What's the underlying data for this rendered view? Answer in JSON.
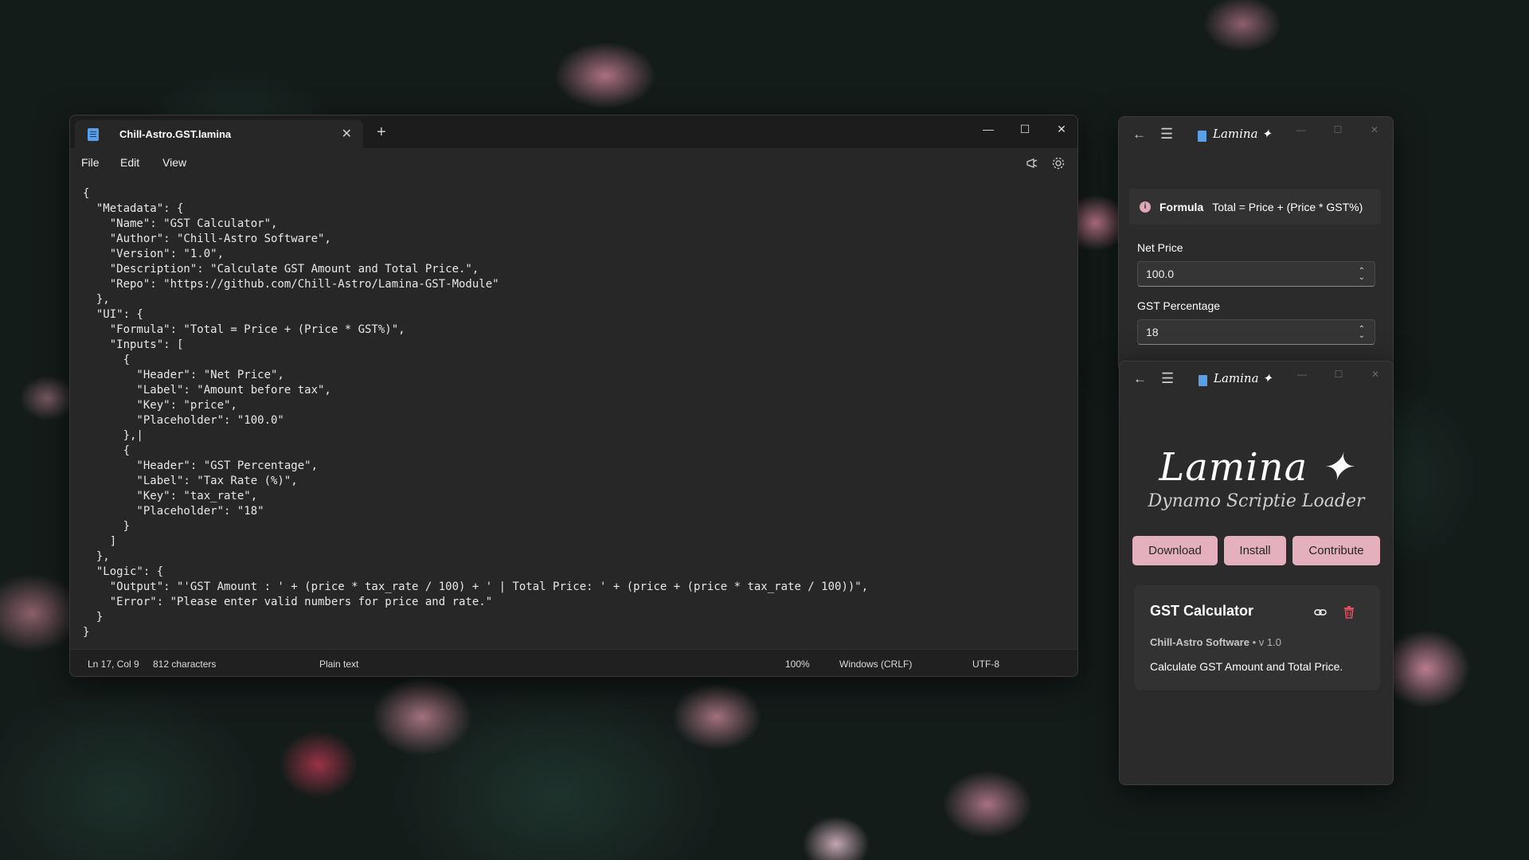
{
  "notepad": {
    "tab_title": "Chill-Astro.GST.lamina",
    "tab_close": "✕",
    "new_tab": "+",
    "controls": {
      "minimize": "—",
      "maximize": "☐",
      "close": "✕"
    },
    "menu": {
      "file": "File",
      "edit": "Edit",
      "view": "View"
    },
    "code": "{\n  \"Metadata\": {\n    \"Name\": \"GST Calculator\",\n    \"Author\": \"Chill-Astro Software\",\n    \"Version\": \"1.0\",\n    \"Description\": \"Calculate GST Amount and Total Price.\",\n    \"Repo\": \"https://github.com/Chill-Astro/Lamina-GST-Module\"\n  },\n  \"UI\": {\n    \"Formula\": \"Total = Price + (Price * GST%)\",\n    \"Inputs\": [\n      {\n        \"Header\": \"Net Price\",\n        \"Label\": \"Amount before tax\",\n        \"Key\": \"price\",\n        \"Placeholder\": \"100.0\"\n      },|\n      {\n        \"Header\": \"GST Percentage\",\n        \"Label\": \"Tax Rate (%)\",\n        \"Key\": \"tax_rate\",\n        \"Placeholder\": \"18\"\n      }\n    ]\n  },\n  \"Logic\": {\n    \"Output\": \"'GST Amount : ' + (price * tax_rate / 100) + ' | Total Price: ' + (price + (price * tax_rate / 100))\",\n    \"Error\": \"Please enter valid numbers for price and rate.\"\n  }\n}",
    "status": {
      "position": "Ln 17, Col 9",
      "characters": "812 characters",
      "format": "Plain text",
      "zoom": "100%",
      "line_ending": "Windows (CRLF)",
      "encoding": "UTF-8"
    }
  },
  "lamina_calc": {
    "app_title": "Lamina ✦",
    "back": "←",
    "menu": "☰",
    "controls": {
      "minimize": "—",
      "maximize": "☐",
      "close": "✕"
    },
    "formula_label": "Formula",
    "formula_text": "Total = Price + (Price * GST%)",
    "inputs": [
      {
        "header": "Net Price",
        "value": "100.0"
      },
      {
        "header": "GST Percentage",
        "value": "18"
      }
    ]
  },
  "lamina_home": {
    "app_title": "Lamina ✦",
    "back": "←",
    "menu": "☰",
    "controls": {
      "minimize": "—",
      "maximize": "☐",
      "close": "✕"
    },
    "brand_title": "Lamina ✦",
    "brand_subtitle": "Dynamo Scriptie Loader",
    "buttons": {
      "download": "Download",
      "install": "Install",
      "contribute": "Contribute"
    },
    "module": {
      "title": "GST Calculator",
      "author": "Chill-Astro Software",
      "version": "• v 1.0",
      "description": "Calculate GST Amount and Total Price."
    }
  },
  "colors": {
    "accent_pink": "#e4b0bd",
    "delete_red": "#e0505a",
    "editor_bg": "#272727"
  }
}
